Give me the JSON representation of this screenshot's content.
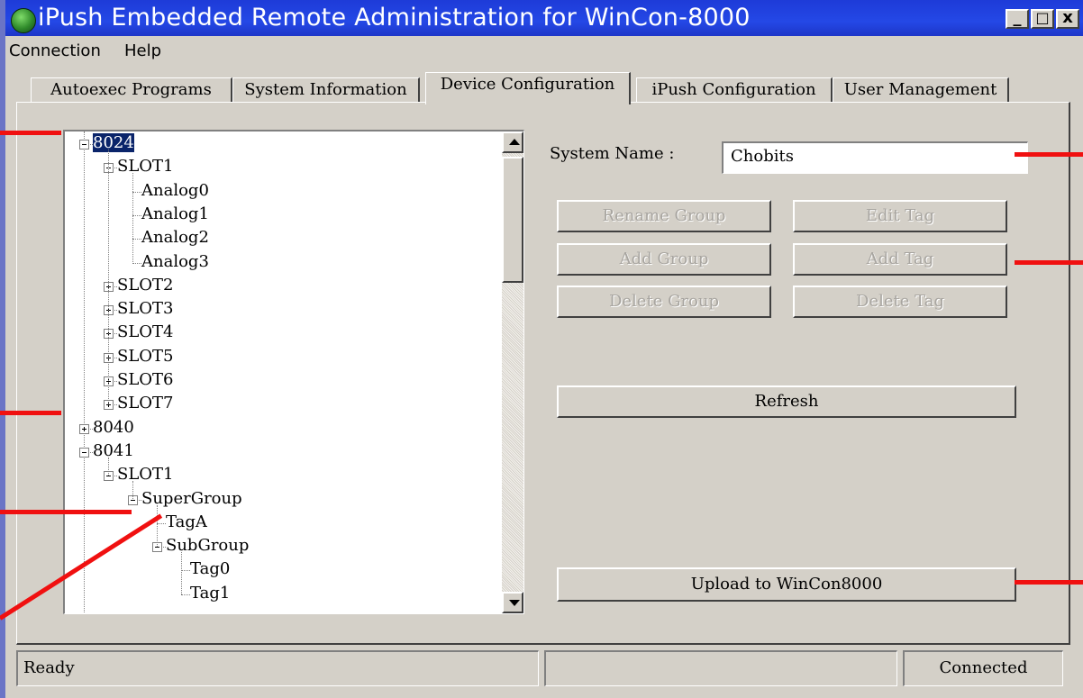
{
  "window": {
    "title": "iPush Embedded Remote Administration for WinCon-8000",
    "controls": {
      "minimize": "_",
      "maximize": "□",
      "close": "x"
    }
  },
  "menu": [
    "Connection",
    "Help"
  ],
  "tabs": [
    "Autoexec Programs",
    "System Information",
    "Device Configuration",
    "iPush Configuration",
    "User Management"
  ],
  "active_tab": "Device Configuration",
  "tree": {
    "nodes": [
      {
        "label": "8024",
        "level": 0,
        "expander": "minus",
        "selected": true
      },
      {
        "label": "SLOT1",
        "level": 1,
        "expander": "minus"
      },
      {
        "label": "Analog0",
        "level": 2,
        "expander": "none"
      },
      {
        "label": "Analog1",
        "level": 2,
        "expander": "none"
      },
      {
        "label": "Analog2",
        "level": 2,
        "expander": "none"
      },
      {
        "label": "Analog3",
        "level": 2,
        "expander": "none"
      },
      {
        "label": "SLOT2",
        "level": 1,
        "expander": "plus"
      },
      {
        "label": "SLOT3",
        "level": 1,
        "expander": "plus"
      },
      {
        "label": "SLOT4",
        "level": 1,
        "expander": "plus"
      },
      {
        "label": "SLOT5",
        "level": 1,
        "expander": "plus"
      },
      {
        "label": "SLOT6",
        "level": 1,
        "expander": "plus"
      },
      {
        "label": "SLOT7",
        "level": 1,
        "expander": "plus"
      },
      {
        "label": "8040",
        "level": 0,
        "expander": "plus"
      },
      {
        "label": "8041",
        "level": 0,
        "expander": "minus"
      },
      {
        "label": "SLOT1",
        "level": 1,
        "expander": "minus"
      },
      {
        "label": "SuperGroup",
        "level": 2,
        "expander": "minus"
      },
      {
        "label": "TagA",
        "level": 3,
        "expander": "none"
      },
      {
        "label": "SubGroup",
        "level": 3,
        "expander": "minus"
      },
      {
        "label": "Tag0",
        "level": 4,
        "expander": "none"
      },
      {
        "label": "Tag1",
        "level": 4,
        "expander": "none"
      }
    ]
  },
  "form": {
    "system_name_label": "System Name :",
    "system_name_value": "Chobits"
  },
  "buttons": {
    "rename_group": "Rename Group",
    "edit_tag": "Edit Tag",
    "add_group": "Add Group",
    "add_tag": "Add Tag",
    "delete_group": "Delete Group",
    "delete_tag": "Delete Tag",
    "refresh": "Refresh",
    "upload": "Upload to WinCon8000"
  },
  "status": {
    "left": "Ready",
    "middle": "",
    "right": "Connected"
  },
  "colors": {
    "title_bar": "#2448e6",
    "background": "#6a74c6",
    "annotation": "#f01010",
    "selection": "#0a246a"
  }
}
